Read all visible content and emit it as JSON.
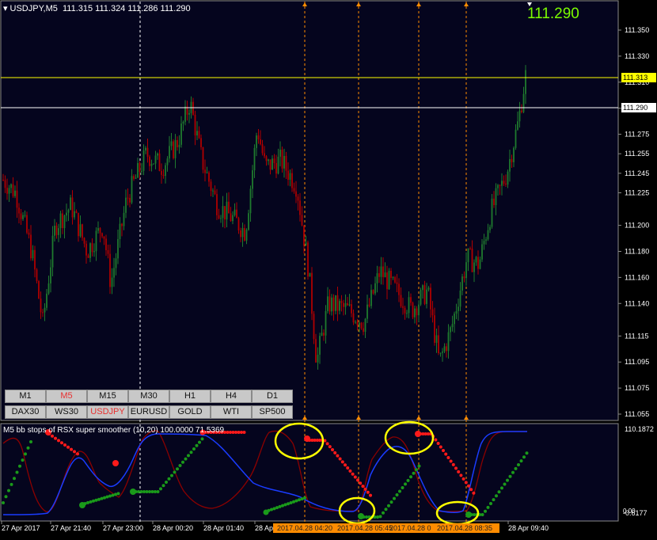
{
  "header": {
    "symbol": "USDJPY,M5",
    "ohlc": "111.315 111.324 111.286 111.290"
  },
  "big_price": "111.290",
  "price_axis": {
    "labels": [
      "111.350",
      "111.330",
      "111.310",
      "111.290",
      "111.275",
      "111.255",
      "111.245",
      "111.225",
      "111.200",
      "111.180",
      "111.160",
      "111.140",
      "111.115",
      "111.095",
      "111.075",
      "111.055"
    ],
    "values": [
      111.35,
      111.33,
      111.31,
      111.29,
      111.27,
      111.255,
      111.24,
      111.225,
      111.2,
      111.18,
      111.16,
      111.14,
      111.115,
      111.095,
      111.075,
      111.055
    ]
  },
  "price_lines": [
    {
      "label": "111.313",
      "value": 111.313,
      "color": "#ffff00",
      "text_color": "#000000"
    },
    {
      "label": "111.290",
      "value": 111.29,
      "color": "#ffffff",
      "text_color": "#000000"
    }
  ],
  "timeframes": {
    "row1": [
      "M1",
      "M5",
      "M15",
      "M30",
      "H1",
      "H4",
      "D1"
    ],
    "row2": [
      "DAX30",
      "WS30",
      "USDJPY",
      "EURUSD",
      "GOLD",
      "WTI",
      "SP500"
    ],
    "active": [
      "M5",
      "USDJPY"
    ]
  },
  "indicator": {
    "title": "M5 bb stops of RSX super smoother (10,20) 100.0000 71.5369",
    "axis_top": "110.1872",
    "axis_bottom": "-0.6177",
    "axis_bottom_overlap": "0.00"
  },
  "time_axis": {
    "labels": [
      "27 Apr 2017",
      "27 Apr 21:40",
      "27 Apr 23:00",
      "28 Apr 00:20",
      "28 Apr 01:40",
      "28 Ap",
      "28 Apr 09:40"
    ],
    "highlight_labels": [
      "2017.04.28 04:20",
      "2017.04.28 05:45",
      "2017.04.28 0",
      "2017.04.28 08:35"
    ],
    "highlight_overlaps": [
      "2017.0",
      "2017.0"
    ]
  },
  "colors": {
    "up": "#1f7a2e",
    "down": "#b00000",
    "grid": "#ffffff",
    "axis_text": "#ffffff",
    "highlight": "#ff8c00",
    "red_dots": "#ff1a1a",
    "green_dots": "#1a9a1a",
    "blue_line": "#1a3cff",
    "darkred_line": "#8b0000",
    "circle": "#ffff00"
  }
}
